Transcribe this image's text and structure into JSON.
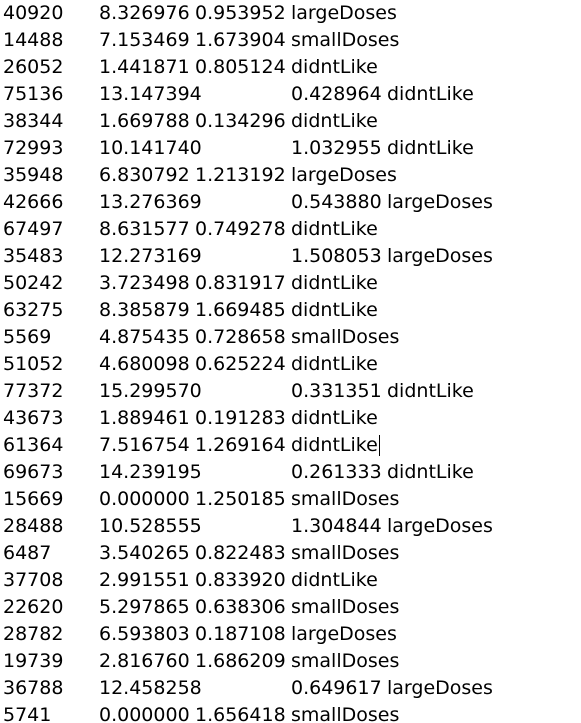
{
  "lines": [
    "40920\t8.326976\t0.953952\tlargeDoses",
    "14488\t7.153469\t1.673904\tsmallDoses",
    "26052\t1.441871\t0.805124\tdidntLike",
    "75136\t13.147394\t0.428964\tdidntLike",
    "38344\t1.669788\t0.134296\tdidntLike",
    "72993\t10.141740\t1.032955\tdidntLike",
    "35948\t6.830792\t1.213192\tlargeDoses",
    "42666\t13.276369\t0.543880\tlargeDoses",
    "67497\t8.631577\t0.749278\tdidntLike",
    "35483\t12.273169\t1.508053\tlargeDoses",
    "50242\t3.723498\t0.831917\tdidntLike",
    "63275\t8.385879\t1.669485\tdidntLike",
    "5569\t4.875435\t0.728658\tsmallDoses",
    "51052\t4.680098\t0.625224\tdidntLike",
    "77372\t15.299570\t0.331351\tdidntLike",
    "43673\t1.889461\t0.191283\tdidntLike",
    "61364\t7.516754\t1.269164\tdidntLike",
    "69673\t14.239195\t0.261333\tdidntLike",
    "15669\t0.000000\t1.250185\tsmallDoses",
    "28488\t10.528555\t1.304844\tlargeDoses",
    "6487\t3.540265\t0.822483\tsmallDoses",
    "37708\t2.991551\t0.833920\tdidntLike",
    "22620\t5.297865\t0.638306\tsmallDoses",
    "28782\t6.593803\t0.187108\tlargeDoses",
    "19739\t2.816760\t1.686209\tsmallDoses",
    "36788\t12.458258\t0.649617\tlargeDoses",
    "5741\t0.000000\t1.656418\tsmallDoses"
  ]
}
